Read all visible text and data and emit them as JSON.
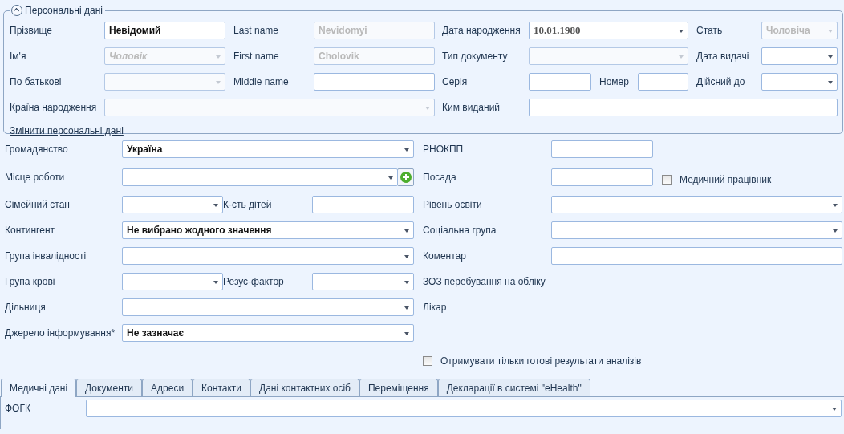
{
  "personal": {
    "title": "Персональні дані",
    "expanded": true,
    "rows": [
      {
        "left": [
          {
            "label": "Прізвище",
            "kind": "text",
            "value": "Невідомий",
            "disabled": false
          },
          {
            "label": "Last name",
            "kind": "text",
            "value": "Nevidomyi",
            "disabled": true
          }
        ],
        "right": [
          {
            "label": "Дата народження",
            "kind": "date",
            "value": "10.01.1980",
            "disabled": false
          },
          {
            "label": "Стать",
            "kind": "combo",
            "value": "Чоловіча",
            "disabled": true
          }
        ]
      },
      {
        "left": [
          {
            "label": "Ім'я",
            "kind": "combo",
            "placeholder": "Чоловік",
            "disabled": true
          },
          {
            "label": "First name",
            "kind": "text",
            "value": "Cholovik",
            "disabled": true
          }
        ],
        "right": [
          {
            "label": "Тип документу",
            "kind": "combo",
            "disabled": true
          },
          {
            "label": "Дата видачі",
            "kind": "combo",
            "disabled": false
          }
        ]
      },
      {
        "left": [
          {
            "label": "По батькові",
            "kind": "combo",
            "disabled": true
          },
          {
            "label": "Middle name",
            "kind": "text",
            "disabled": false
          }
        ],
        "right": [
          {
            "label": "Серія",
            "kind": "text",
            "disabled": false
          },
          {
            "label": "Номер",
            "kind": "text",
            "disabled": false
          },
          {
            "label": "Дійсний до",
            "kind": "combo",
            "disabled": false
          }
        ]
      },
      {
        "left": [
          {
            "label": "Країна народження",
            "kind": "combo",
            "disabled": true
          }
        ],
        "right": [
          {
            "label": "Ким виданий",
            "kind": "text",
            "disabled": false
          }
        ]
      }
    ],
    "link": "Змінити персональні дані"
  },
  "details": {
    "rows": [
      {
        "left": [
          {
            "label": "Громадянство",
            "kind": "combo",
            "value": "Україна"
          }
        ],
        "right": [
          {
            "label": "РНОКПП",
            "kind": "text"
          }
        ]
      },
      {
        "left": [
          {
            "label": "Місце роботи",
            "kind": "combo_add"
          }
        ],
        "right": [
          {
            "label": "Посада",
            "kind": "text"
          },
          {
            "label": "Медичний працівник",
            "kind": "checkbox",
            "checked": false
          }
        ]
      },
      {
        "left": [
          {
            "label": "Сімейний стан",
            "kind": "combo"
          },
          {
            "label": "К-сть дітей",
            "kind": "text"
          }
        ],
        "right": [
          {
            "label": "Рівень освіти",
            "kind": "combo"
          }
        ]
      },
      {
        "left": [
          {
            "label": "Контингент",
            "kind": "combo",
            "value": "Не вибрано жодного значення"
          }
        ],
        "right": [
          {
            "label": "Соціальна група",
            "kind": "combo"
          }
        ]
      },
      {
        "left": [
          {
            "label": "Група інвалідності",
            "kind": "combo"
          }
        ],
        "right": [
          {
            "label": "Коментар",
            "kind": "text"
          }
        ]
      },
      {
        "left": [
          {
            "label": "Група крові",
            "kind": "combo"
          },
          {
            "label": "Резус-фактор",
            "kind": "combo"
          }
        ],
        "right": [
          {
            "label": "ЗОЗ перебування на обліку",
            "kind": "label"
          }
        ]
      },
      {
        "left": [
          {
            "label": "Дільниця",
            "kind": "combo"
          }
        ],
        "right": [
          {
            "label": "Лікар",
            "kind": "label"
          }
        ]
      },
      {
        "left": [
          {
            "label": "Джерело інформування*",
            "kind": "combo",
            "value": "Не зазначає"
          }
        ],
        "right": []
      }
    ],
    "checkbox": {
      "label": "Отримувати тільки готові результати аналізів",
      "checked": false
    }
  },
  "tabs": [
    {
      "label": "Медичні дані",
      "selected": true
    },
    {
      "label": "Документи",
      "selected": false
    },
    {
      "label": "Адреси",
      "selected": false
    },
    {
      "label": "Контакти",
      "selected": false
    },
    {
      "label": "Дані контактних осіб",
      "selected": false
    },
    {
      "label": "Переміщення",
      "selected": false
    },
    {
      "label": "Декларації в системі \"eHealth\"",
      "selected": false
    }
  ],
  "tab_content": {
    "fields": [
      {
        "label": "ФОГК",
        "kind": "combo"
      }
    ]
  }
}
